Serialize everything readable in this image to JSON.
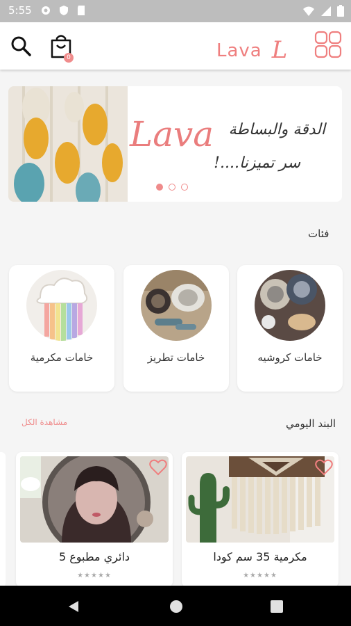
{
  "status_bar": {
    "time": "5:55",
    "icons": [
      "gear-icon",
      "shield-icon",
      "sd-card-icon",
      "wifi-icon",
      "signal-icon",
      "battery-icon"
    ]
  },
  "app_bar": {
    "brand": "Lava",
    "brand_mark": "L",
    "cart_count": "0",
    "accent_color": "#ef7f7f"
  },
  "banner": {
    "brand": "Lava",
    "line1": "الدقة والبساطة",
    "line2": "سر تميزنا....!",
    "slides": 3,
    "active_slide": 1
  },
  "categories": {
    "title": "فئات",
    "items": [
      {
        "label": "خامات كروشيه",
        "icon": "crochet-photo"
      },
      {
        "label": "خامات تطريز",
        "icon": "embroidery-photo"
      },
      {
        "label": "خامات مكرمية",
        "icon": "macrame-photo"
      }
    ]
  },
  "daily": {
    "title": "البند اليومي",
    "view_all": "مشاهدة الكل",
    "products": [
      {
        "name": "مكرمية  35 سم كودا",
        "stars": "★★★★★",
        "rating": 0
      },
      {
        "name": "دائري مطبوع 5",
        "stars": "★★★★★",
        "rating": 0
      }
    ]
  },
  "nav_bar": {
    "buttons": [
      "back-icon",
      "home-icon",
      "recents-icon"
    ]
  }
}
